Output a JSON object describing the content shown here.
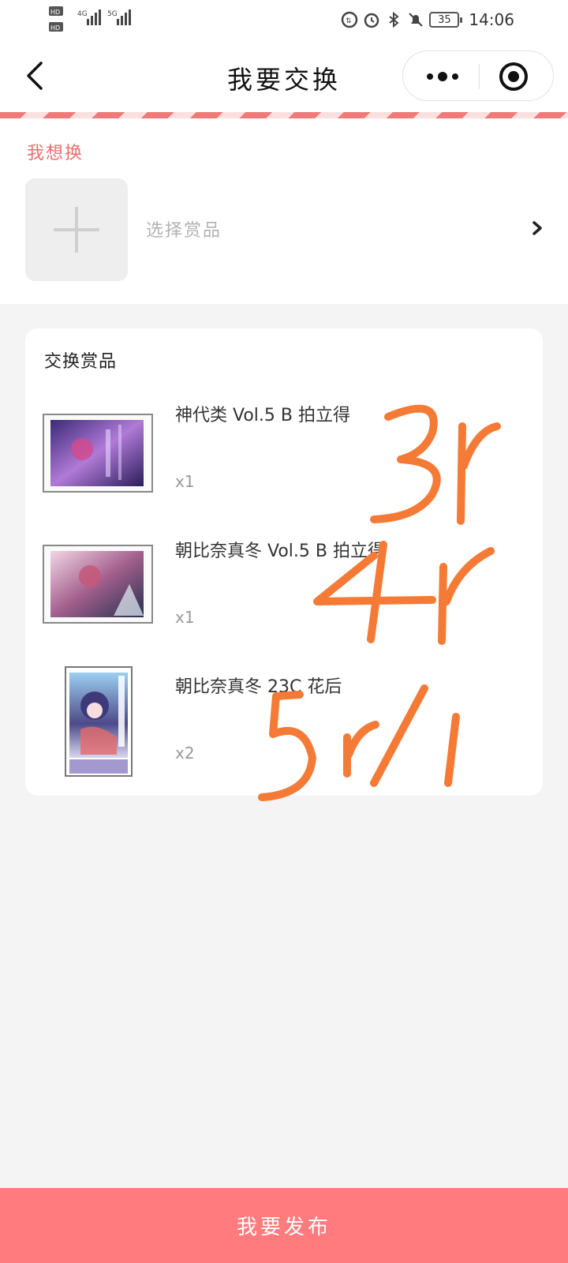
{
  "status_bar": {
    "sim1": "HD 1",
    "sim2": "HD 2",
    "net1": "4G",
    "net2": "5G",
    "battery": "35",
    "time": "14:06"
  },
  "nav": {
    "title": "我要交换",
    "back_icon": "chevron-left-icon",
    "more_icon": "more-dots-icon",
    "close_icon": "target-close-icon"
  },
  "want": {
    "label": "我想换",
    "placeholder": "选择赏品",
    "add_icon": "plus-icon"
  },
  "exchange": {
    "title": "交换赏品",
    "items": [
      {
        "name": "神代类 Vol.5 B 拍立得",
        "qty": "x1"
      },
      {
        "name": "朝比奈真冬 Vol.5 B 拍立得",
        "qty": "x1"
      },
      {
        "name": "朝比奈真冬 23C 花后",
        "qty": "x2"
      }
    ]
  },
  "handwritten_notes": [
    "3r",
    "4r",
    "5r/1"
  ],
  "publish_button": "我要发布",
  "colors": {
    "accent": "#e8706e",
    "publish_bg": "#ff7b7d",
    "handwriting": "#f47a36",
    "page_bg": "#f4f4f4"
  }
}
